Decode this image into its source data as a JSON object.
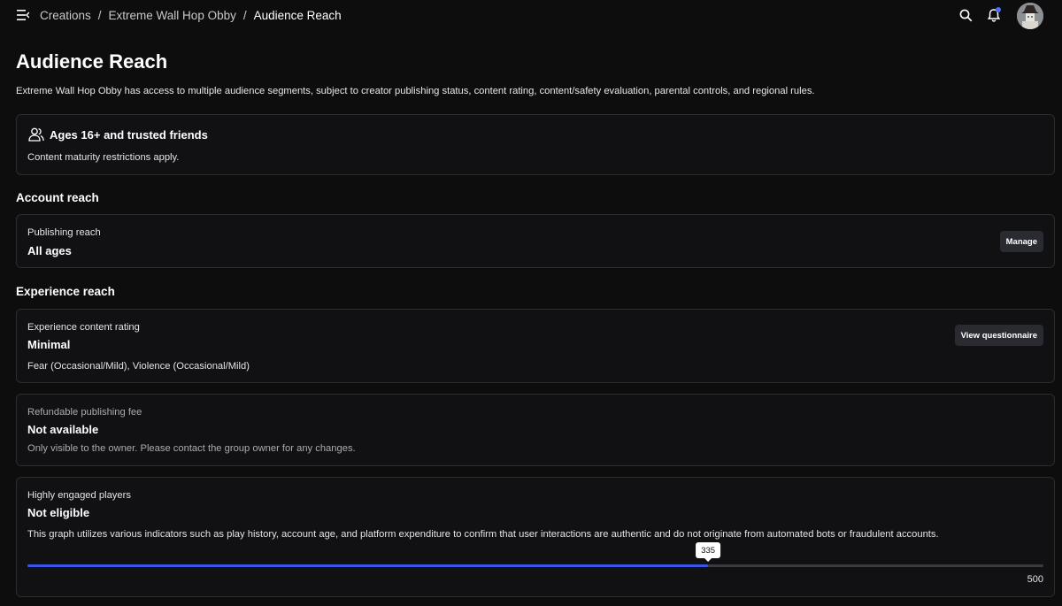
{
  "breadcrumb": {
    "items": [
      "Creations",
      "Extreme Wall Hop Obby",
      "Audience Reach"
    ],
    "separator": "/"
  },
  "icons": {
    "menu": "menu-collapse-icon",
    "search": "search-icon",
    "notifications": "bell-icon",
    "audience": "people-icon"
  },
  "colors": {
    "accent": "#3a55e8",
    "notification_dot": "#4a6cff"
  },
  "page": {
    "title": "Audience Reach",
    "description": "Extreme Wall Hop Obby has access to multiple audience segments, subject to creator publishing status, content rating, content/safety evaluation, parental controls, and regional rules."
  },
  "audience_card": {
    "title": "Ages 16+ and trusted friends",
    "note": "Content maturity restrictions apply."
  },
  "account_reach": {
    "heading": "Account reach",
    "label": "Publishing reach",
    "value": "All ages",
    "button": "Manage"
  },
  "experience_reach": {
    "heading": "Experience reach",
    "rating": {
      "label": "Experience content rating",
      "value": "Minimal",
      "descriptors": "Fear (Occasional/Mild), Violence (Occasional/Mild)",
      "button": "View questionnaire"
    },
    "fee": {
      "label": "Refundable publishing fee",
      "value": "Not available",
      "note": "Only visible to the owner. Please contact the group owner for any changes."
    },
    "engaged": {
      "label": "Highly engaged players",
      "value": "Not eligible",
      "note": "This graph utilizes various indicators such as play history, account age, and platform expenditure to confirm that user interactions are authentic and do not originate from automated bots or fraudulent accounts.",
      "progress_value": "335",
      "progress_max": "500"
    }
  }
}
